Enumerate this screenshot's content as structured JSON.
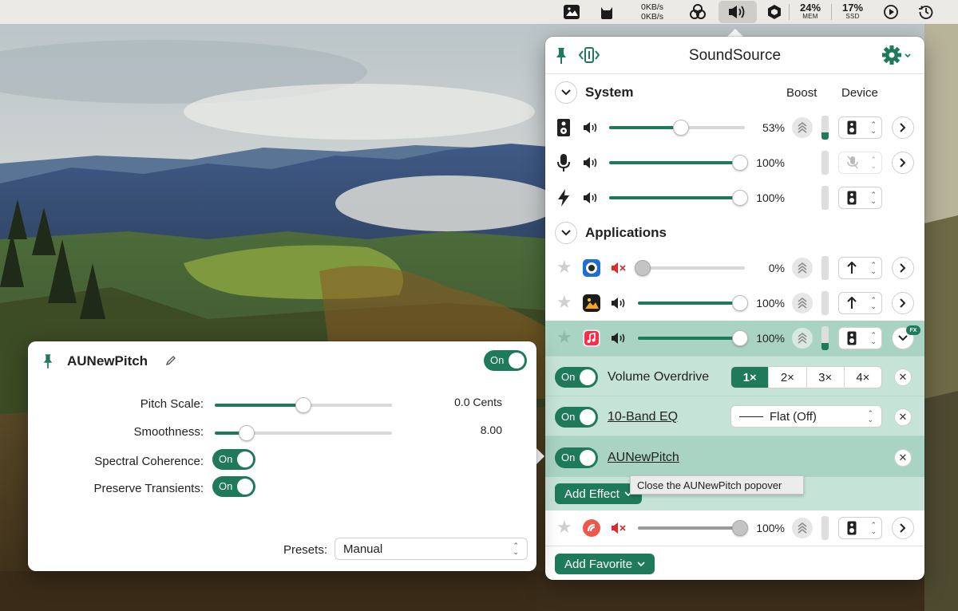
{
  "menubar": {
    "net_up": "0KB/s",
    "net_down": "0KB/s",
    "mem_value": "24%",
    "mem_label": "MEM",
    "ssd_value": "17%",
    "ssd_label": "SSD"
  },
  "soundsource": {
    "title": "SoundSource",
    "system": {
      "title": "System",
      "boost_header": "Boost",
      "device_header": "Device",
      "rows": [
        {
          "icon": "speaker-icon",
          "volume_pct": 53,
          "label": "53%"
        },
        {
          "icon": "microphone-icon",
          "volume_pct": 100,
          "label": "100%"
        },
        {
          "icon": "lightning-icon",
          "volume_pct": 100,
          "label": "100%"
        }
      ]
    },
    "applications": {
      "title": "Applications",
      "rows": [
        {
          "app": "app-icon-blue",
          "muted": true,
          "volume_pct": 0,
          "label": "0%"
        },
        {
          "app": "app-icon-preview",
          "muted": false,
          "volume_pct": 100,
          "label": "100%"
        },
        {
          "app": "app-icon-music",
          "muted": false,
          "volume_pct": 100,
          "label": "100%",
          "fx_badge": "FX"
        },
        {
          "app": "app-icon-red",
          "muted": true,
          "volume_pct": 100,
          "label": "100%"
        }
      ]
    },
    "effects": [
      {
        "toggle": "On",
        "name": "Volume Overdrive",
        "options": [
          "1×",
          "2×",
          "3×",
          "4×"
        ],
        "selected": "1×"
      },
      {
        "toggle": "On",
        "name": "10-Band EQ",
        "preset": "Flat (Off)"
      },
      {
        "toggle": "On",
        "name": "AUNewPitch"
      }
    ],
    "add_effect": "Add Effect",
    "add_favorite": "Add Favorite",
    "tooltip": "Close the AUNewPitch popover"
  },
  "au_popover": {
    "title": "AUNewPitch",
    "toggle": "On",
    "params": [
      {
        "label": "Pitch Scale:",
        "value": "0.0 Cents",
        "slider_fraction": 0.5
      },
      {
        "label": "Smoothness:",
        "value": "8.00",
        "slider_fraction": 0.18
      }
    ],
    "spectral_label": "Spectral Coherence:",
    "spectral_toggle": "On",
    "transients_label": "Preserve Transients:",
    "transients_toggle": "On",
    "presets_label": "Presets:",
    "presets_value": "Manual"
  },
  "colors": {
    "accent": "#1e7a5a",
    "highlight_row": "#a9d3c3"
  }
}
